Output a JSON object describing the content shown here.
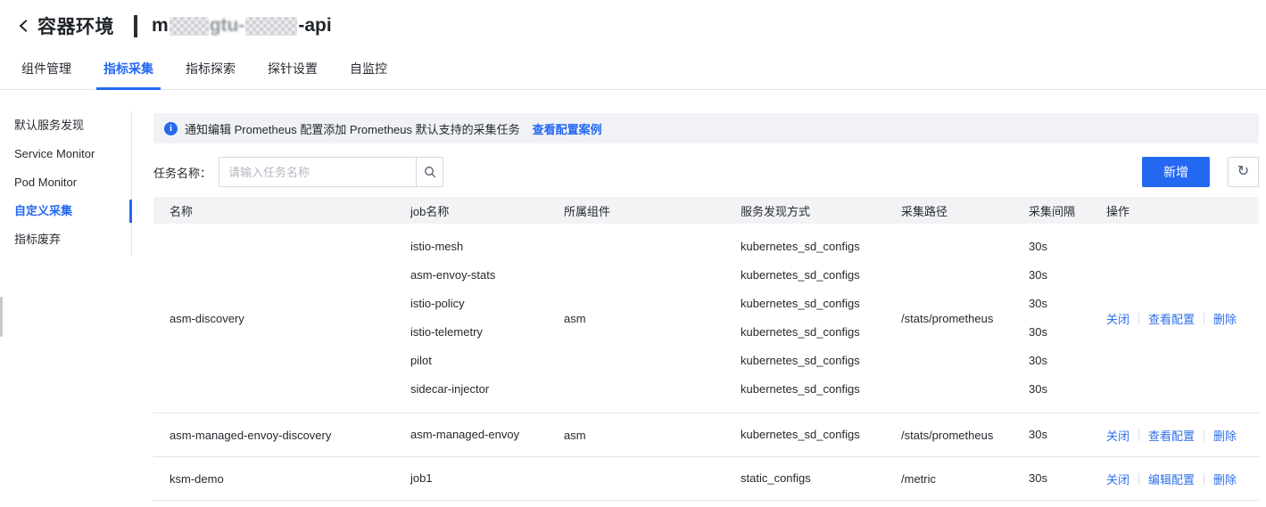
{
  "colors": {
    "accent": "#2468f2",
    "link": "#2f6fe8",
    "banner_bg": "#f0f2f6",
    "table_header_bg": "#f2f3f5"
  },
  "header": {
    "back_icon": "chevron-left",
    "section_title": "容器环境",
    "env_name_prefix": "m",
    "env_name_mid": "gtu-",
    "env_name_suffix": "-api"
  },
  "tabs": [
    {
      "label": "组件管理",
      "name": "tab-component-management",
      "active": false
    },
    {
      "label": "指标采集",
      "name": "tab-metric-collection",
      "active": true
    },
    {
      "label": "指标探索",
      "name": "tab-metric-explore",
      "active": false
    },
    {
      "label": "探针设置",
      "name": "tab-probe-settings",
      "active": false
    },
    {
      "label": "自监控",
      "name": "tab-self-monitoring",
      "active": false
    }
  ],
  "sidebar": {
    "items": [
      {
        "label": "默认服务发现",
        "name": "sidebar-item-default-service-discovery",
        "active": false
      },
      {
        "label": "Service Monitor",
        "name": "sidebar-item-service-monitor",
        "active": false
      },
      {
        "label": "Pod Monitor",
        "name": "sidebar-item-pod-monitor",
        "active": false
      },
      {
        "label": "自定义采集",
        "name": "sidebar-item-custom-collection",
        "active": true
      },
      {
        "label": "指标废弃",
        "name": "sidebar-item-metric-deprecation",
        "active": false
      }
    ]
  },
  "banner": {
    "icon": "info-icon",
    "text": "通知编辑 Prometheus 配置添加 Prometheus 默认支持的采集任务",
    "link": "查看配置案例"
  },
  "filter": {
    "label": "任务名称：",
    "placeholder": "请输入任务名称",
    "search_icon": "magnifier",
    "add_button": "新增",
    "refresh_icon_glyph": "↻"
  },
  "table": {
    "columns": [
      "名称",
      "job名称",
      "所属组件",
      "服务发现方式",
      "采集路径",
      "采集间隔",
      "操作"
    ],
    "rows": [
      {
        "name": "asm-discovery",
        "component": "asm",
        "path": "/stats/prometheus",
        "jobs": [
          {
            "job": "istio-mesh",
            "sd": "kubernetes_sd_configs",
            "interval": "30s"
          },
          {
            "job": "asm-envoy-stats",
            "sd": "kubernetes_sd_configs",
            "interval": "30s"
          },
          {
            "job": "istio-policy",
            "sd": "kubernetes_sd_configs",
            "interval": "30s"
          },
          {
            "job": "istio-telemetry",
            "sd": "kubernetes_sd_configs",
            "interval": "30s"
          },
          {
            "job": "pilot",
            "sd": "kubernetes_sd_configs",
            "interval": "30s"
          },
          {
            "job": "sidecar-injector",
            "sd": "kubernetes_sd_configs",
            "interval": "30s"
          }
        ],
        "actions": [
          {
            "label": "关闭",
            "name": "close-action-link"
          },
          {
            "label": "查看配置",
            "name": "view-config-action-link"
          },
          {
            "label": "删除",
            "name": "delete-action-link"
          }
        ]
      },
      {
        "name": "asm-managed-envoy-discovery",
        "component": "asm",
        "path": "/stats/prometheus",
        "jobs": [
          {
            "job": "asm-managed-envoy",
            "sd": "kubernetes_sd_configs",
            "interval": "30s"
          }
        ],
        "actions": [
          {
            "label": "关闭",
            "name": "close-action-link"
          },
          {
            "label": "查看配置",
            "name": "view-config-action-link"
          },
          {
            "label": "删除",
            "name": "delete-action-link"
          }
        ]
      },
      {
        "name": "ksm-demo",
        "component": "",
        "path": "/metric",
        "jobs": [
          {
            "job": "job1",
            "sd": "static_configs",
            "interval": "30s"
          }
        ],
        "actions": [
          {
            "label": "关闭",
            "name": "close-action-link"
          },
          {
            "label": "编辑配置",
            "name": "edit-config-action-link"
          },
          {
            "label": "删除",
            "name": "delete-action-link"
          }
        ]
      }
    ]
  }
}
